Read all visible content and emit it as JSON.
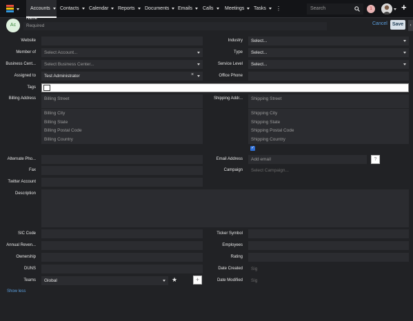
{
  "nav": {
    "items": [
      "Accounts",
      "Contacts",
      "Calendar",
      "Reports",
      "Documents",
      "Emails",
      "Calls",
      "Meetings",
      "Tasks"
    ],
    "more": "⋮",
    "search_placeholder": "Search",
    "notification_count": "1",
    "plus": "+"
  },
  "header": {
    "avatar_initials": "Ac",
    "name_label": "Name",
    "name_placeholder": "Required",
    "cancel": "Cancel",
    "save": "Save"
  },
  "form": {
    "website_label": "Website",
    "industry_label": "Industry",
    "industry_value": "Select...",
    "member_of_label": "Member of",
    "member_of_value": "Select Account...",
    "type_label": "Type",
    "type_value": "Select...",
    "business_center_label": "Business Cent...",
    "business_center_value": "Select Business Center...",
    "service_level_label": "Service Level",
    "service_level_value": "Select...",
    "assigned_to_label": "Assigned to",
    "assigned_to_value": "Test Administrator",
    "office_phone_label": "Office Phone",
    "tags_label": "Tags",
    "billing_address_label": "Billing Address",
    "billing_street": "Billing Street",
    "billing_city": "Billing City",
    "billing_state": "Billing State",
    "billing_postal": "Billing Postal Code",
    "billing_country": "Billing Country",
    "shipping_address_label": "Shipping Addr...",
    "shipping_street": "Shipping Street",
    "shipping_city": "Shipping City",
    "shipping_state": "Shipping State",
    "shipping_postal": "Shipping Postal Code",
    "shipping_country": "Shipping Country",
    "alt_phone_label": "Alternate Pho...",
    "email_label": "Email Address",
    "email_placeholder": "Add email",
    "fax_label": "Fax",
    "campaign_label": "Campaign",
    "campaign_placeholder": "Select Campaign...",
    "twitter_label": "Twitter Account",
    "description_label": "Description",
    "sic_label": "SIC Code",
    "ticker_label": "Ticker Symbol",
    "revenue_label": "Annual Reven...",
    "employees_label": "Employees",
    "ownership_label": "Ownership",
    "rating_label": "Rating",
    "duns_label": "DUNS",
    "date_created_label": "Date Created",
    "date_created_value": "Sig",
    "teams_label": "Teams",
    "teams_value": "Global",
    "date_modified_label": "Date Modified",
    "date_modified_value": "Sig",
    "show_less": "Show less"
  },
  "colors": {
    "accent": "#5ca0e0",
    "save_bg": "#d9e2ea",
    "avatar_bg": "#dff2df",
    "avatar_fg": "#3b8a3b"
  }
}
